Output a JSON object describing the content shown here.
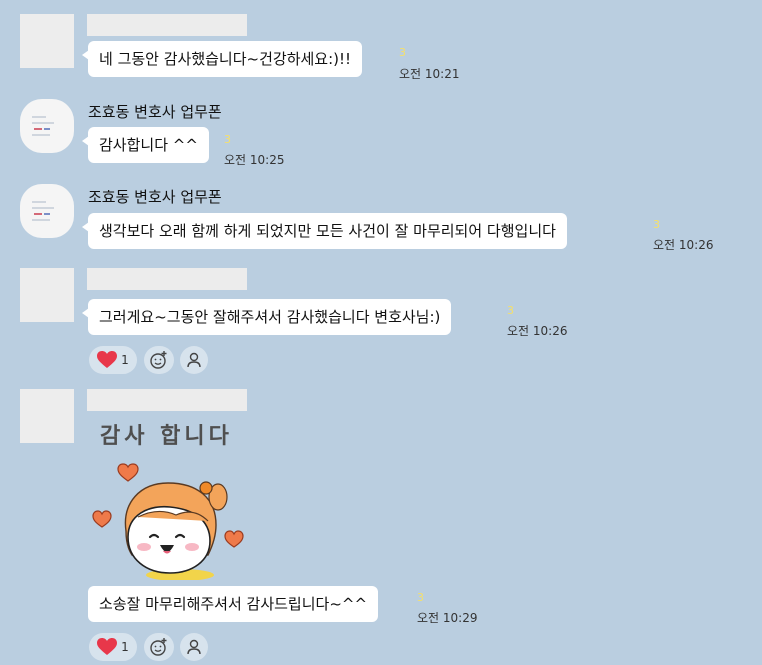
{
  "messages": [
    {
      "text": "네 그동안 감사했습니다~건강하세요:)!!",
      "unread": "3",
      "time": "오전 10:21"
    },
    {
      "sender": "조효동 변호사 업무폰",
      "text": "감사합니다 ^^",
      "unread": "3",
      "time": "오전 10:25"
    },
    {
      "sender": "조효동 변호사 업무폰",
      "text": "생각보다 오래 함께 하게 되었지만 모든 사건이 잘 마무리되어 다행입니다",
      "unread": "3",
      "time": "오전 10:26"
    },
    {
      "text": "그러게요~그동안 잘해주셔서 감사했습니다 변호사님:)",
      "unread": "3",
      "time": "오전 10:26",
      "reaction_count": "1"
    },
    {
      "sticker_text": "감사 합니다",
      "text": "소송잘 마무리해주셔서 감사드립니다~^^",
      "unread": "3",
      "time": "오전 10:29",
      "reaction_count": "1"
    }
  ],
  "icons": {
    "heart": "heart-icon",
    "add_reaction": "add-reaction-icon",
    "person": "person-icon"
  },
  "colors": {
    "background": "#bacee0",
    "bubble": "#ffffff",
    "unread": "#f5e06b",
    "heart": "#e8374a",
    "reaction_pill": "#d7e3ed"
  }
}
